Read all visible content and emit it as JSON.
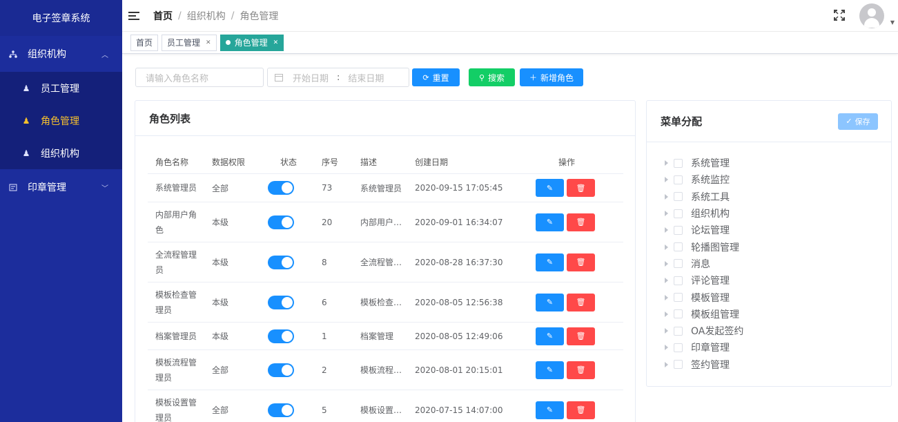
{
  "sidebar": {
    "logo": "电子签章系统",
    "groups": [
      {
        "label": "组织机构",
        "items": [
          {
            "label": "员工管理"
          },
          {
            "label": "角色管理"
          },
          {
            "label": "组织机构"
          }
        ]
      },
      {
        "label": "印章管理"
      }
    ],
    "active_color": "#f7c12d",
    "bg_color": "#1c2d9c"
  },
  "header": {
    "breadcrumb": [
      "首页",
      "组织机构",
      "角色管理"
    ]
  },
  "tabs": [
    {
      "label": "首页",
      "closable": false,
      "active": false
    },
    {
      "label": "员工管理",
      "closable": true,
      "active": false
    },
    {
      "label": "角色管理",
      "closable": true,
      "active": true
    }
  ],
  "search": {
    "role_placeholder": "请输入角色名称",
    "start_placeholder": "开始日期",
    "range_sep": ":",
    "end_placeholder": "结束日期",
    "reset_label": "重置",
    "search_label": "搜索",
    "add_label": "新增角色"
  },
  "roles": {
    "title": "角色列表",
    "columns": [
      "角色名称",
      "数据权限",
      "状态",
      "序号",
      "描述",
      "创建日期",
      "操作"
    ],
    "rows": [
      {
        "name": "系统管理员",
        "scope": "全部",
        "enabled": true,
        "seq": "73",
        "desc": "系统管理员",
        "created": "2020-09-15 17:05:45"
      },
      {
        "name": "内部用户角色",
        "scope": "本级",
        "enabled": true,
        "seq": "20",
        "desc": "内部用户…",
        "created": "2020-09-01 16:34:07"
      },
      {
        "name": "全流程管理员",
        "scope": "本级",
        "enabled": true,
        "seq": "8",
        "desc": "全流程管…",
        "created": "2020-08-28 16:37:30"
      },
      {
        "name": "模板检查管理员",
        "scope": "本级",
        "enabled": true,
        "seq": "6",
        "desc": "模板检查…",
        "created": "2020-08-05 12:56:38"
      },
      {
        "name": "档案管理员",
        "scope": "本级",
        "enabled": true,
        "seq": "1",
        "desc": "档案管理",
        "created": "2020-08-05 12:49:06"
      },
      {
        "name": "模板流程管理员",
        "scope": "全部",
        "enabled": true,
        "seq": "2",
        "desc": "模板流程…",
        "created": "2020-08-01 20:15:01"
      },
      {
        "name": "模板设置管理员",
        "scope": "全部",
        "enabled": true,
        "seq": "5",
        "desc": "模板设置…",
        "created": "2020-07-15 14:07:00"
      }
    ]
  },
  "menu_assign": {
    "title": "菜单分配",
    "save_label": "保存",
    "nodes": [
      "系统管理",
      "系统监控",
      "系统工具",
      "组织机构",
      "论坛管理",
      "轮播图管理",
      "消息",
      "评论管理",
      "模板管理",
      "模板组管理",
      "OA发起签约",
      "印章管理",
      "签约管理"
    ]
  },
  "icons": {
    "reset": "refresh-icon",
    "search": "search-icon",
    "add": "plus-icon",
    "edit": "pencil-icon",
    "delete": "trash-icon",
    "save": "check-icon"
  }
}
